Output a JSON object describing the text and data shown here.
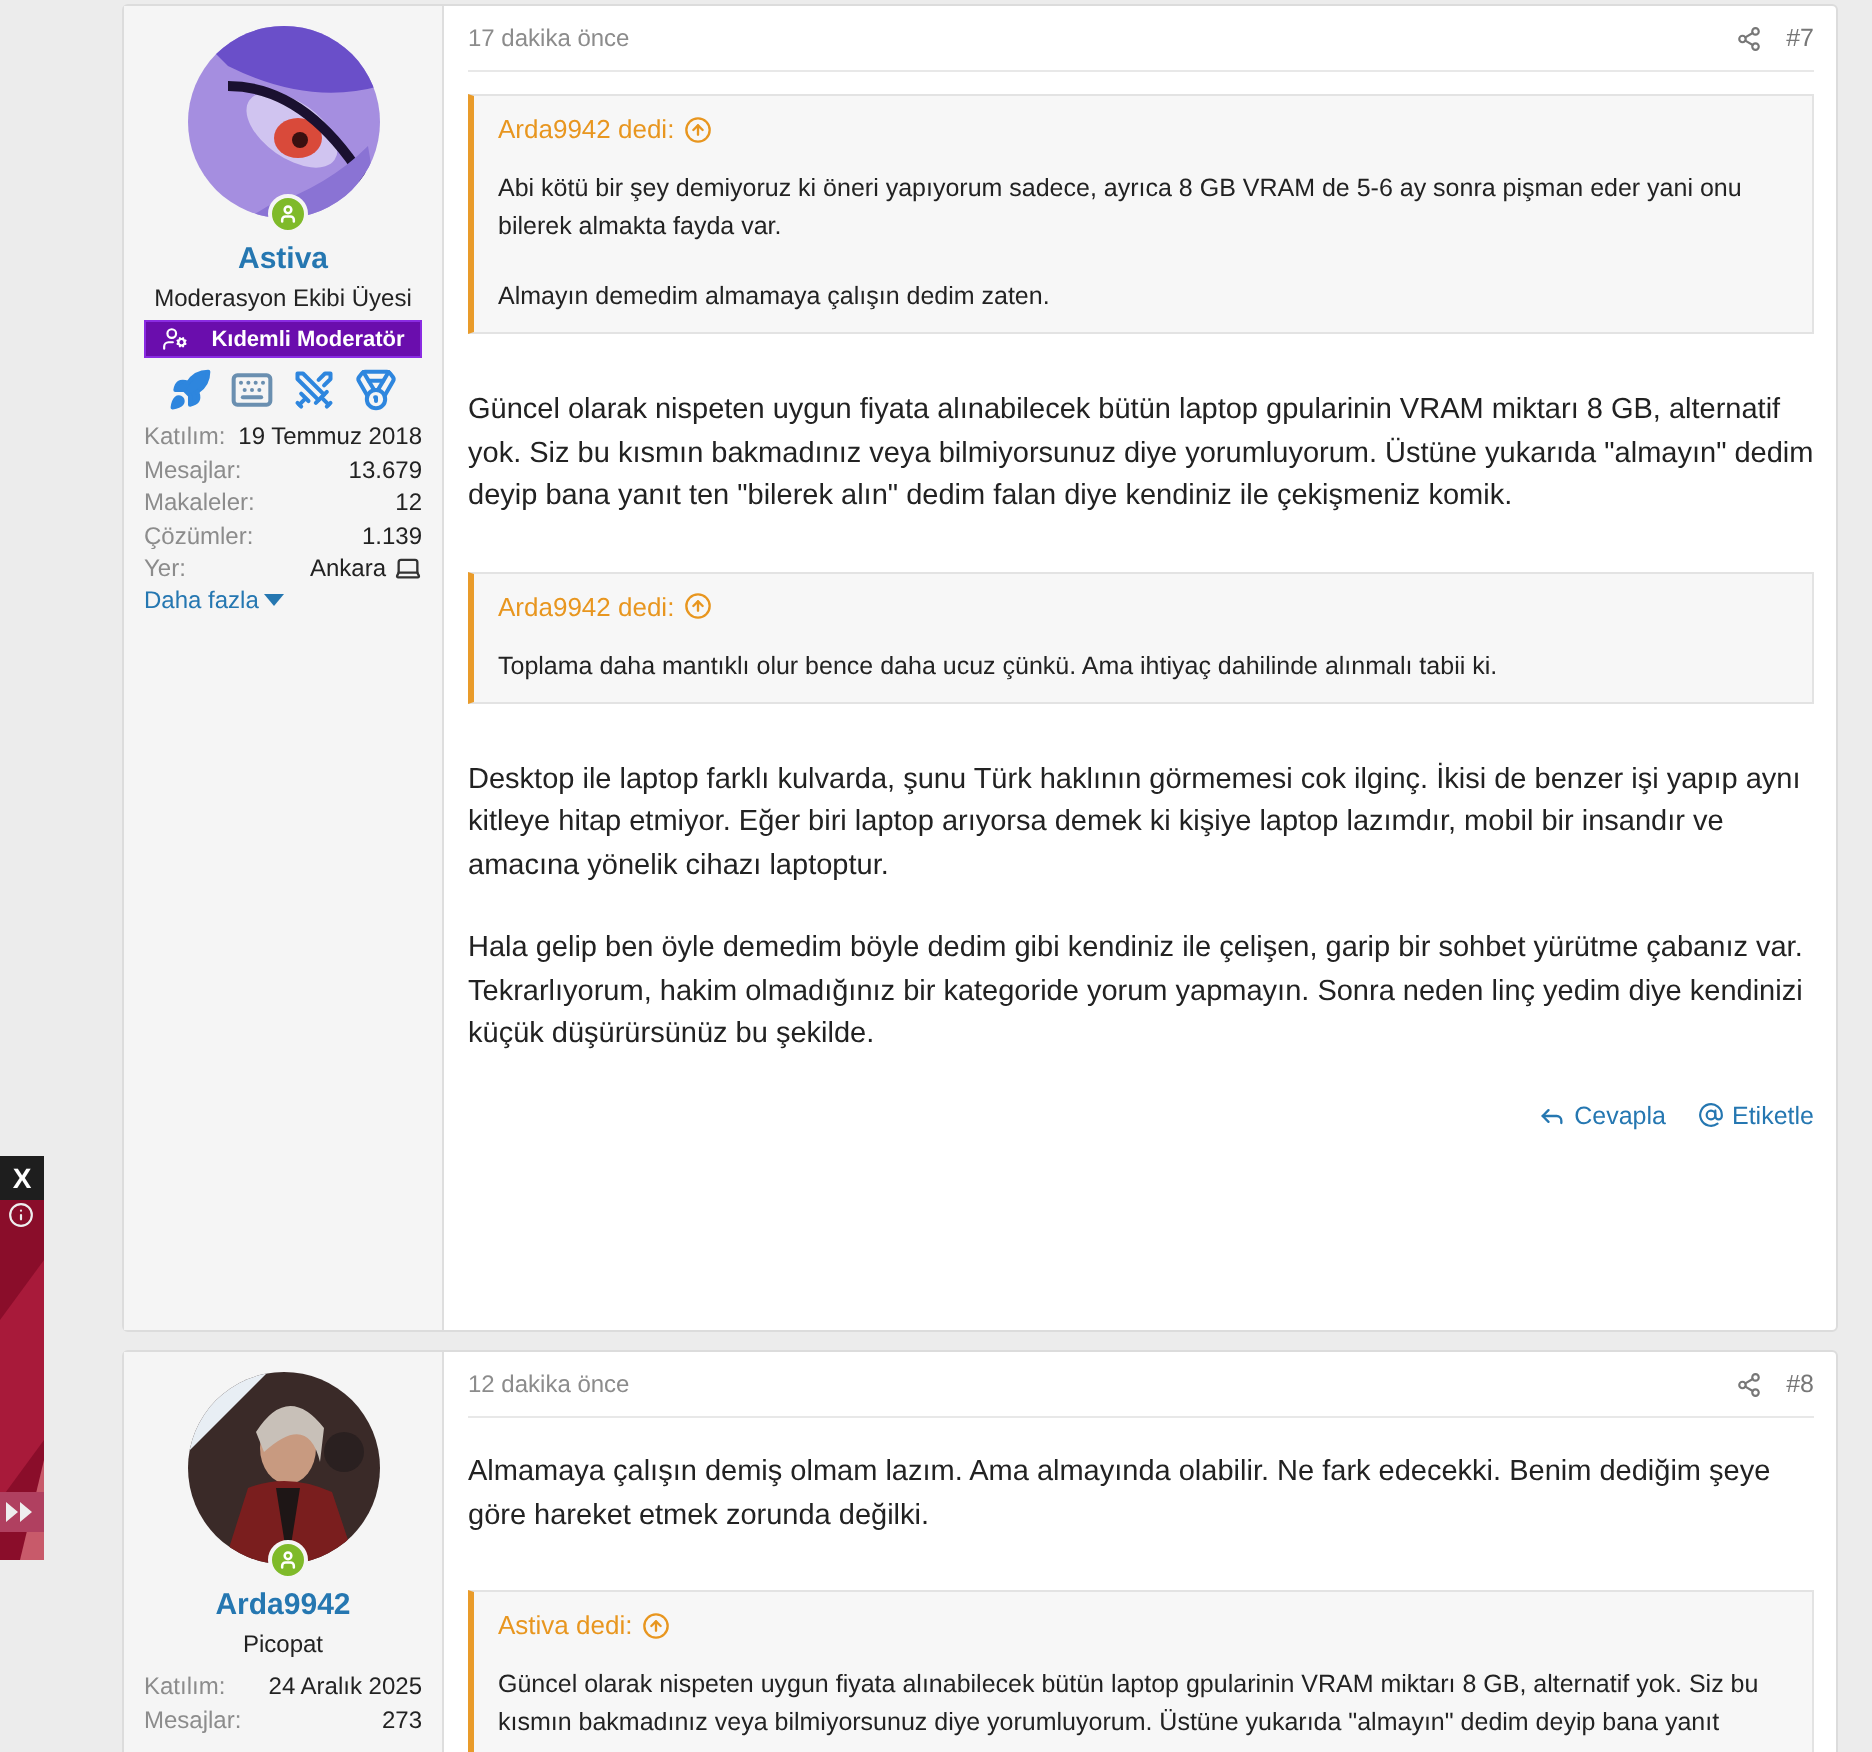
{
  "ad": {
    "close": "X"
  },
  "posts": [
    {
      "author": {
        "name": "Astiva",
        "title": "Moderasyon Ekibi Üyesi",
        "banner": "Kıdemli Moderatör",
        "online": true,
        "badges": [
          {
            "kind": "rocket"
          },
          {
            "kind": "keyboard"
          },
          {
            "kind": "swords"
          },
          {
            "kind": "medal"
          }
        ],
        "stats": [
          {
            "label": "Katılım:",
            "value": "19 Temmuz 2018"
          },
          {
            "label": "Mesajlar:",
            "value": "13.679"
          },
          {
            "label": "Makaleler:",
            "value": "12"
          },
          {
            "label": "Çözümler:",
            "value": "1.139"
          },
          {
            "label": "Yer:",
            "value": "Ankara",
            "kind": "location"
          }
        ],
        "more": "Daha fazla"
      },
      "time": "17 dakika önce",
      "number": "#7",
      "blocks": [
        {
          "kind": "quote",
          "author": "Arda9942 dedi:",
          "paragraphs": [
            "Abi kötü bir şey demiyoruz ki öneri yapıyorum sadece, ayrıca 8 GB VRAM de 5-6 ay sonra pişman eder yani onu bilerek almakta fayda var.",
            "Almayın demedim almamaya çalışın dedim zaten."
          ]
        },
        {
          "kind": "text",
          "paragraphs": [
            "Güncel olarak nispeten uygun fiyata alınabilecek bütün laptop gpularinin VRAM miktarı 8 GB, alternatif yok. Siz bu kısmın bakmadınız veya bilmiyorsunuz diye yorumluyorum. Üstüne yukarıda \"almayın\" dedim deyip bana yanıt ten \"bilerek alın\" dedim falan diye kendiniz ile çekişmeniz komik."
          ]
        },
        {
          "kind": "quote",
          "author": "Arda9942 dedi:",
          "paragraphs": [
            "Toplama daha mantıklı olur bence daha ucuz çünkü. Ama ihtiyaç dahilinde alınmalı tabii ki."
          ]
        },
        {
          "kind": "text",
          "paragraphs": [
            "Desktop ile laptop farklı kulvarda, şunu Türk haklının görmemesi cok ilginç. İkisi de benzer işi yapıp aynı kitleye hitap etmiyor. Eğer biri laptop arıyorsa demek ki kişiye laptop lazımdır, mobil bir insandır ve amacına yönelik cihazı laptoptur.",
            "Hala gelip ben öyle demedim böyle dedim gibi kendiniz ile çelişen, garip bir sohbet yürütme çabanız var. Tekrarlıyorum, hakim olmadığınız bir kategoride yorum yapmayın. Sonra neden linç yedim diye kendinizi küçük düşürürsünüz bu şekilde."
          ]
        }
      ],
      "actions": [
        {
          "kind": "reply",
          "label": "Cevapla"
        },
        {
          "kind": "mention",
          "label": "Etiketle"
        }
      ]
    },
    {
      "author": {
        "name": "Arda9942",
        "title": "Picopat",
        "online": true,
        "stats": [
          {
            "label": "Katılım:",
            "value": "24 Aralık 2025"
          },
          {
            "label": "Mesajlar:",
            "value": "273"
          }
        ]
      },
      "time": "12 dakika önce",
      "number": "#8",
      "blocks": [
        {
          "kind": "text",
          "paragraphs": [
            "Almamaya çalışın demiş olmam lazım. Ama almayında olabilir. Ne fark edecekki. Benim dediğim şeye göre hareket etmek zorunda değilki."
          ]
        },
        {
          "kind": "quote",
          "author": "Astiva dedi:",
          "paragraphs": [
            "Güncel olarak nispeten uygun fiyata alınabilecek bütün laptop gpularinin VRAM miktarı 8 GB, alternatif yok. Siz bu kısmın bakmadınız veya bilmiyorsunuz diye yorumluyorum. Üstüne yukarıda \"almayın\" dedim deyip bana yanıt"
          ]
        }
      ]
    }
  ]
}
